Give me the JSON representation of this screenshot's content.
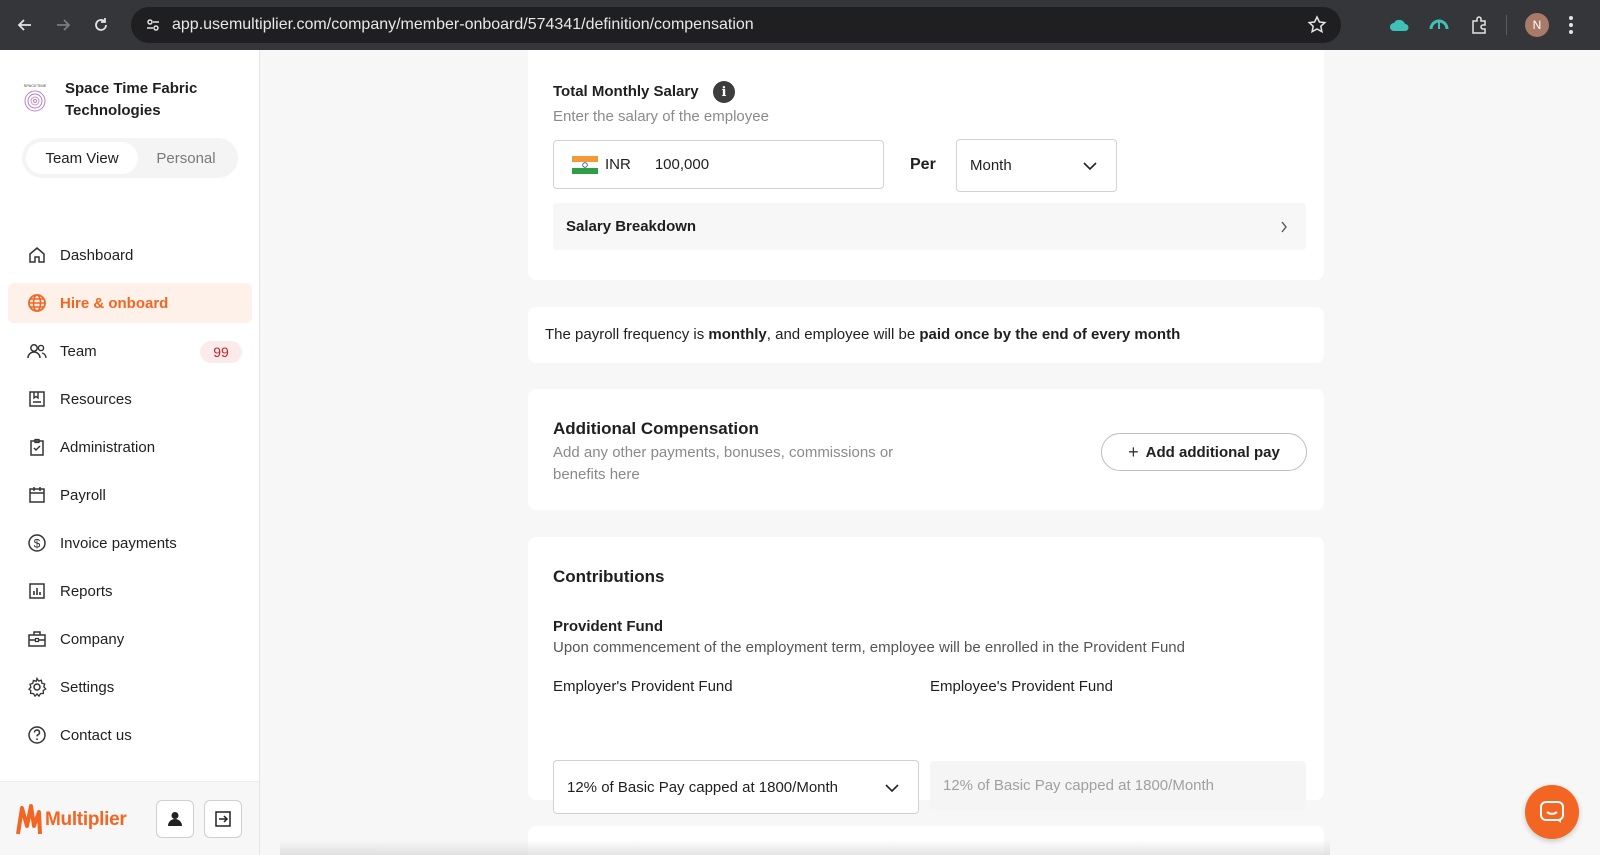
{
  "browser": {
    "url": "app.usemultiplier.com/company/member-onboard/574341/definition/compensation",
    "profile_initial": "N"
  },
  "sidebar": {
    "company_name": "Space Time Fabric Technologies",
    "company_logo_text": "SPACETIME",
    "view_toggle": {
      "active": "Team View",
      "inactive": "Personal"
    },
    "items": [
      {
        "label": "Dashboard",
        "icon": "home-icon"
      },
      {
        "label": "Hire & onboard",
        "icon": "globe-icon",
        "active": true
      },
      {
        "label": "Team",
        "icon": "users-icon",
        "badge": "99"
      },
      {
        "label": "Resources",
        "icon": "resources-icon"
      },
      {
        "label": "Administration",
        "icon": "clipboard-check-icon"
      },
      {
        "label": "Payroll",
        "icon": "calendar-icon"
      },
      {
        "label": "Invoice payments",
        "icon": "dollar-circle-icon"
      },
      {
        "label": "Reports",
        "icon": "chart-icon"
      },
      {
        "label": "Company",
        "icon": "briefcase-icon"
      },
      {
        "label": "Settings",
        "icon": "gear-icon"
      },
      {
        "label": "Contact us",
        "icon": "help-circle-icon"
      }
    ],
    "brand": "Multiplier"
  },
  "salary": {
    "title": "Total Monthly Salary",
    "subtitle": "Enter the salary of the employee",
    "currency": "INR",
    "amount": "100,000",
    "per_label": "Per",
    "period": "Month",
    "breakdown_label": "Salary Breakdown"
  },
  "payroll_frequency": {
    "prefix": "The payroll frequency is ",
    "frequency": "monthly",
    "middle": ", and employee will be ",
    "payment": "paid once by the end of every month"
  },
  "additional_compensation": {
    "title": "Additional Compensation",
    "description": "Add any other payments, bonuses, commissions or benefits here",
    "button": "Add additional pay"
  },
  "contributions": {
    "title": "Contributions",
    "pf_title": "Provident Fund",
    "pf_description": "Upon commencement of the employment term, employee will be enrolled in the Provident Fund",
    "employer_label": "Employer's Provident Fund",
    "employer_value": "12% of Basic Pay capped at 1800/Month",
    "employee_label": "Employee's Provident Fund",
    "employee_value": "12% of Basic Pay capped at 1800/Month"
  },
  "colors": {
    "brand_orange": "#f26522",
    "active_bg": "#fef1ea",
    "badge_bg": "#fdeaea",
    "badge_text": "#c0262d"
  }
}
